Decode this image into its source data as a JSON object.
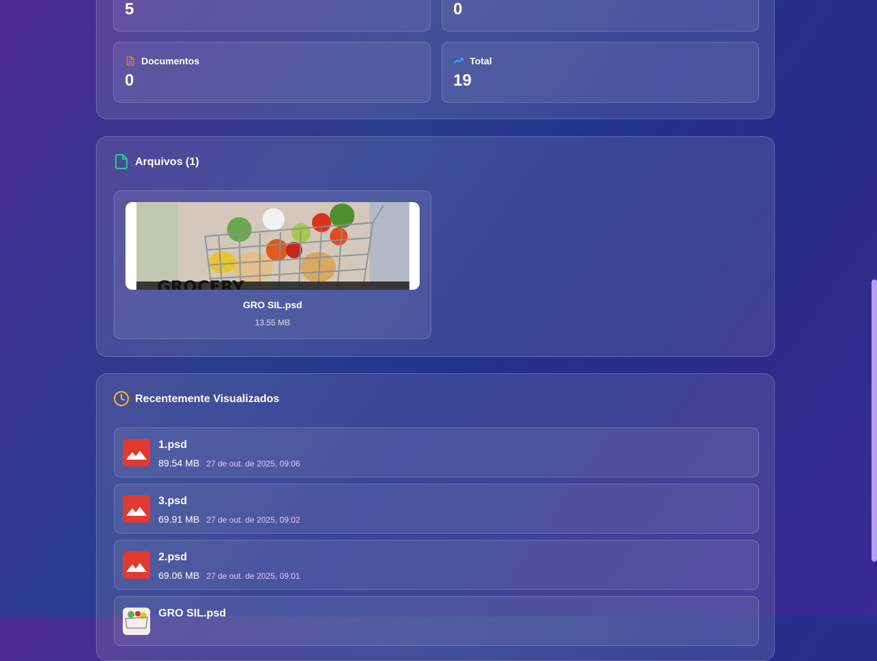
{
  "stats": {
    "top_left_value": "5",
    "top_right_value": "0",
    "documents": {
      "label": "Documentos",
      "value": "0",
      "icon": "document-icon",
      "color": "#f07a3c"
    },
    "total": {
      "label": "Total",
      "value": "19",
      "icon": "trending-up-icon",
      "color": "#3fb7ff"
    }
  },
  "files": {
    "title": "Arquivos (1)",
    "icon": "file-icon",
    "icon_color": "#22d08a",
    "items": [
      {
        "name": "GRO SIL.psd",
        "size": "13.55 MB",
        "thumb_text": "GROCERY"
      }
    ]
  },
  "recent": {
    "title": "Recentemente Visualizados",
    "icon": "clock-icon",
    "icon_color": "#f5c02b",
    "items": [
      {
        "name": "1.psd",
        "size": "89.54 MB",
        "date": "27 de out. de 2025, 09:06"
      },
      {
        "name": "3.psd",
        "size": "69.91 MB",
        "date": "27 de out. de 2025, 09:02"
      },
      {
        "name": "2.psd",
        "size": "69.06 MB",
        "date": "27 de out. de 2025, 09:01"
      },
      {
        "name": "GRO SIL.psd"
      }
    ]
  }
}
